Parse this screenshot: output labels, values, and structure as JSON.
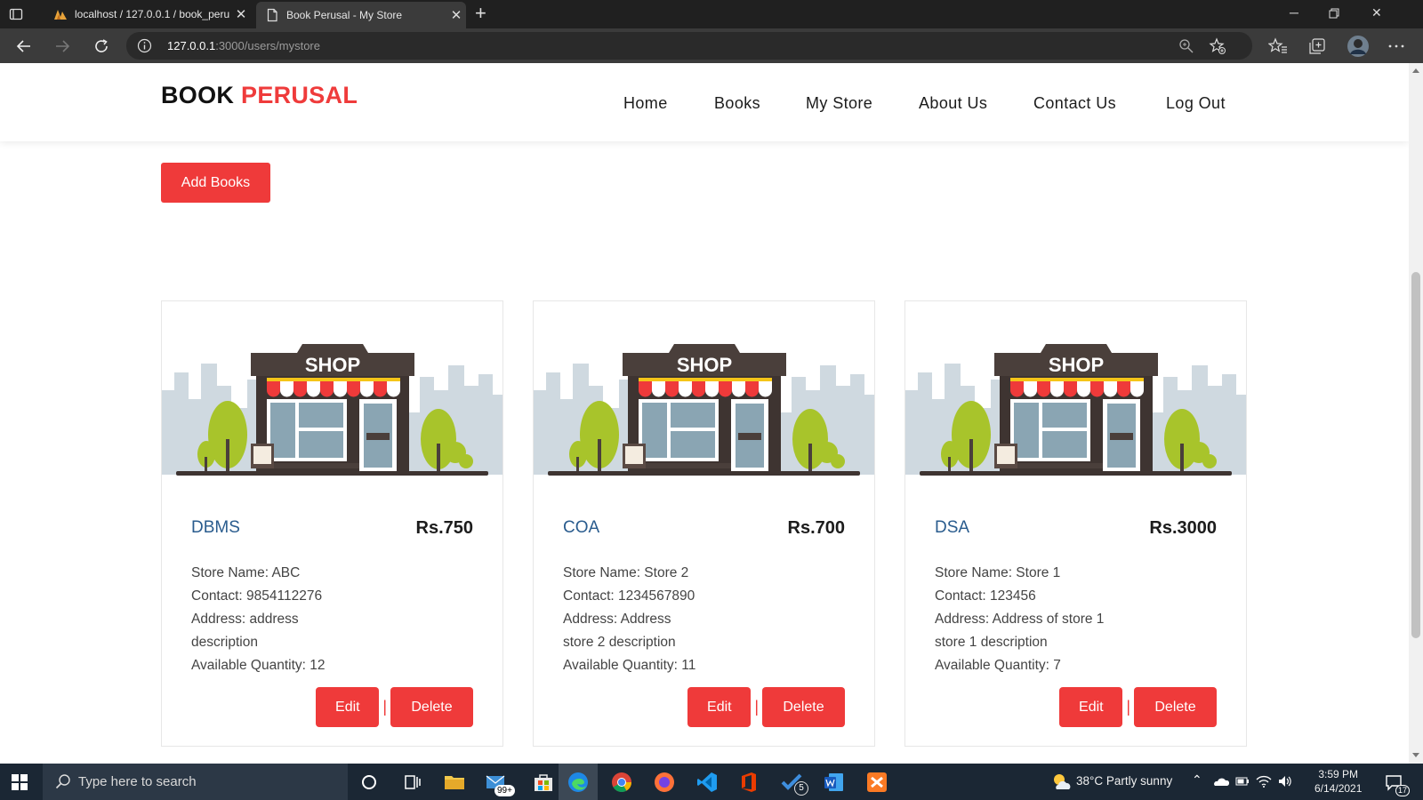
{
  "browser": {
    "tabs": [
      {
        "title": "localhost / 127.0.0.1 / book_peru",
        "active": false
      },
      {
        "title": "Book Perusal - My Store",
        "active": true
      }
    ],
    "url_host": "127.0.0.1",
    "url_rest": ":3000/users/mystore"
  },
  "site": {
    "brand_part1": "BOOK",
    "brand_part2": "PERUSAL",
    "nav": [
      "Home",
      "Books",
      "My Store",
      "About Us",
      "Contact Us",
      "Log Out"
    ],
    "add_books_label": "Add Books",
    "edit_label": "Edit",
    "delete_label": "Delete",
    "separator": "|"
  },
  "cards": [
    {
      "title": "DBMS",
      "price": "Rs.750",
      "store": "Store Name: ABC",
      "contact": "Contact: 9854112276",
      "address": "Address: address description",
      "quantity": "Available Quantity: 12",
      "image_sign": "SHOP"
    },
    {
      "title": "COA",
      "price": "Rs.700",
      "store": "Store Name: Store 2",
      "contact": "Contact: 1234567890",
      "address": "Address: Address store 2 description",
      "quantity": "Available Quantity: 11",
      "image_sign": "SHOP"
    },
    {
      "title": "DSA",
      "price": "Rs.3000",
      "store": "Store Name: Store 1",
      "contact": "Contact: 123456",
      "address": "Address: Address of store 1 store 1 description",
      "quantity": "Available Quantity: 7",
      "image_sign": "SHOP"
    }
  ],
  "taskbar": {
    "search_placeholder": "Type here to search",
    "mail_badge": "99+",
    "tasks_badge": "5",
    "weather": "38°C  Partly sunny",
    "time": "3:59 PM",
    "date": "6/14/2021",
    "notification_count": "17"
  },
  "colors": {
    "accent": "#ef3a3a",
    "title_blue": "#2a5c8e",
    "taskbar": "#1b2734"
  }
}
